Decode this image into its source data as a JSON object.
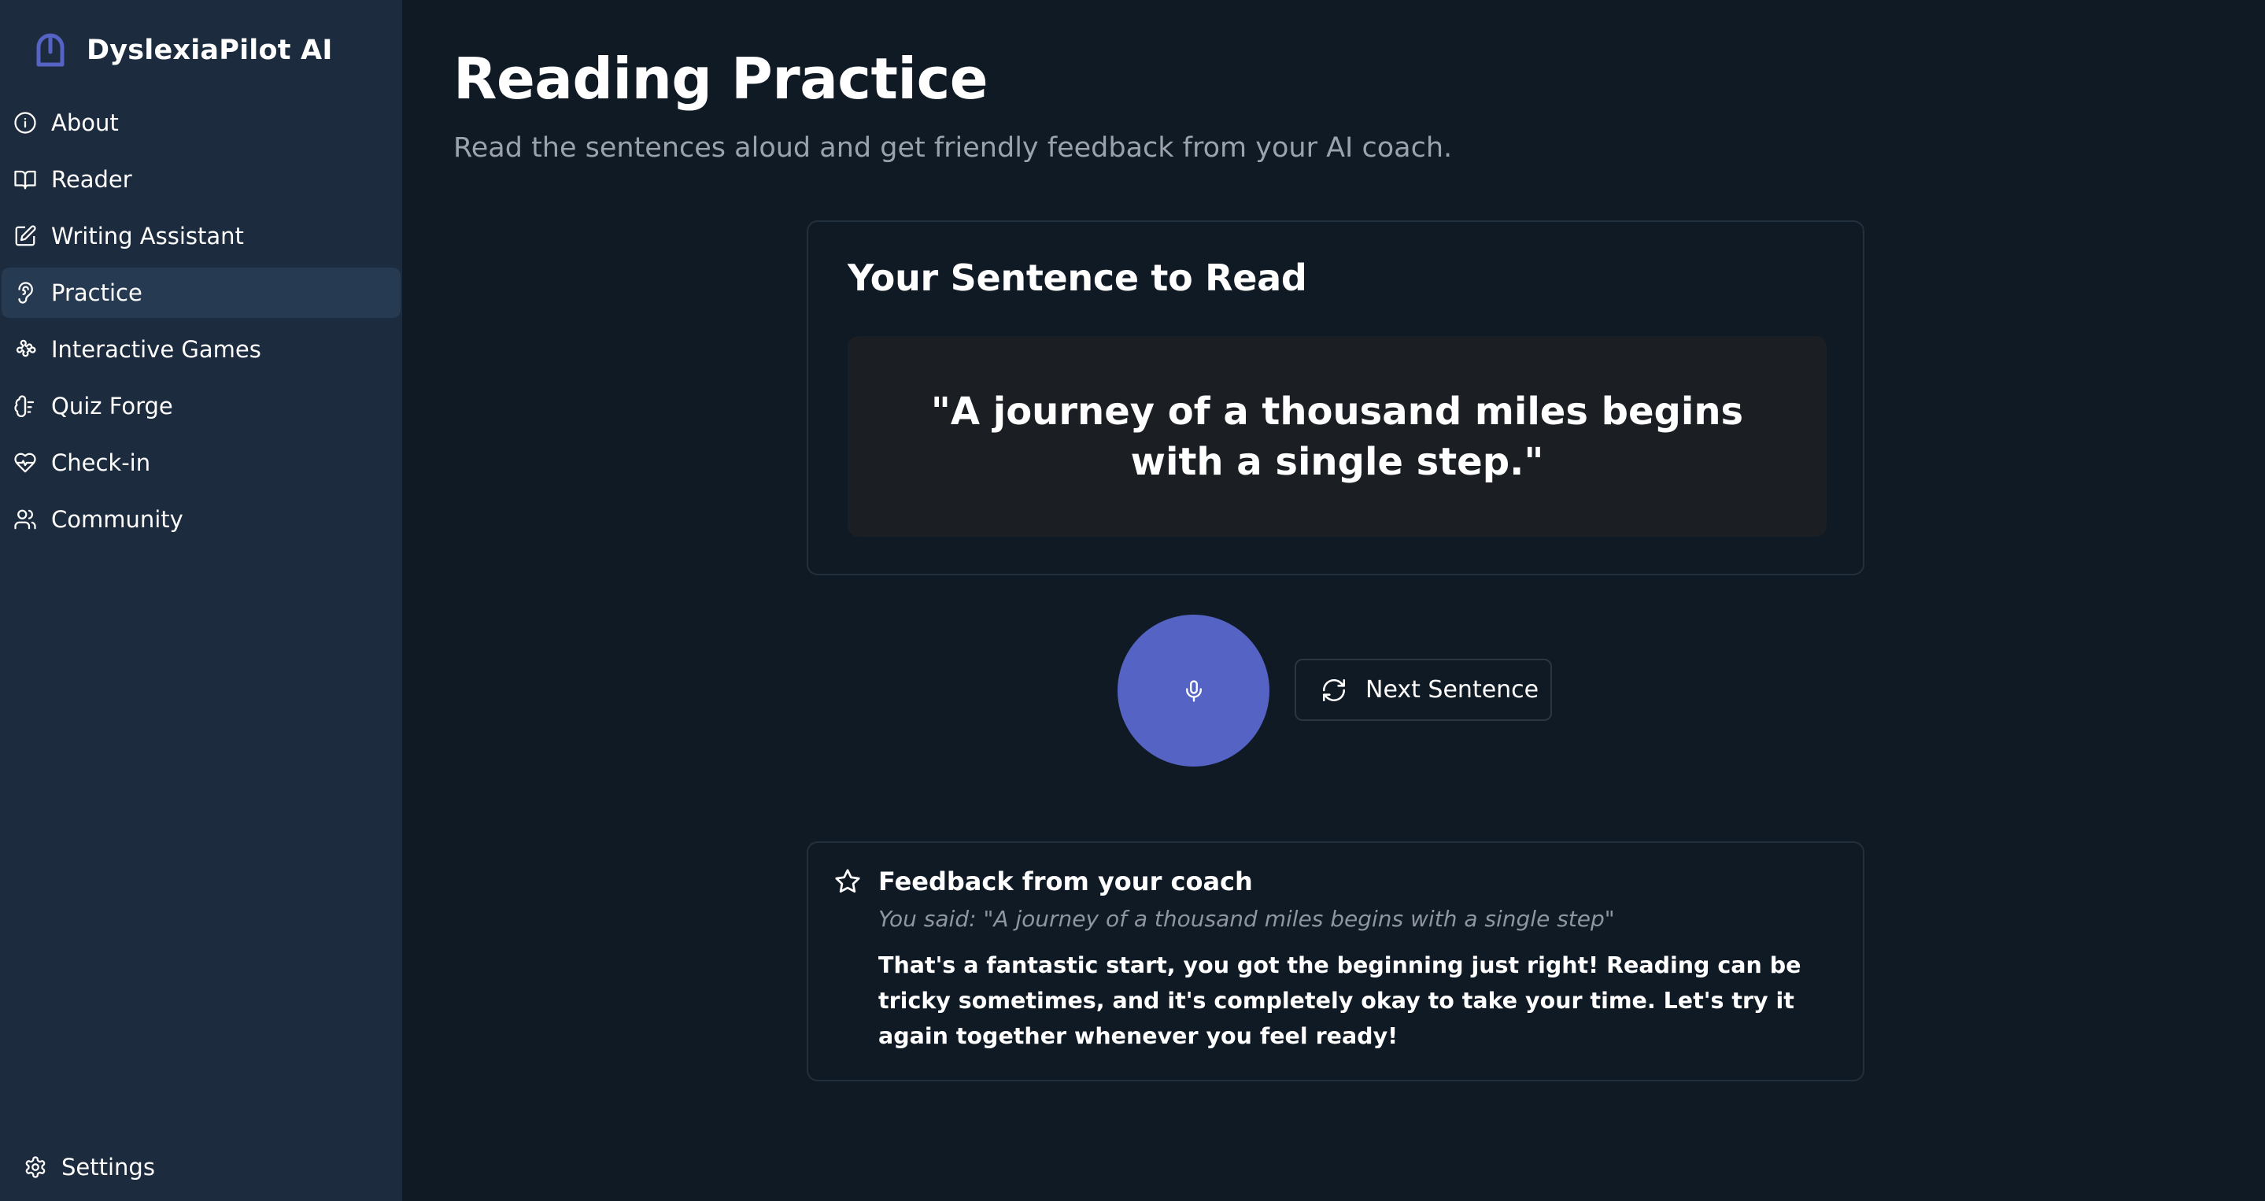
{
  "app": {
    "name": "DyslexiaPilot AI",
    "accent_color": "#5563c5"
  },
  "sidebar": {
    "items": [
      {
        "label": "About",
        "icon": "info-icon",
        "active": false
      },
      {
        "label": "Reader",
        "icon": "book-open-icon",
        "active": false
      },
      {
        "label": "Writing Assistant",
        "icon": "edit-icon",
        "active": false
      },
      {
        "label": "Practice",
        "icon": "ear-icon",
        "active": true
      },
      {
        "label": "Interactive Games",
        "icon": "puzzle-icon",
        "active": false
      },
      {
        "label": "Quiz Forge",
        "icon": "brain-icon",
        "active": false
      },
      {
        "label": "Check-in",
        "icon": "heart-pulse-icon",
        "active": false
      },
      {
        "label": "Community",
        "icon": "users-icon",
        "active": false
      }
    ],
    "settings_label": "Settings"
  },
  "main": {
    "title": "Reading Practice",
    "subtitle": "Read the sentences aloud and get friendly feedback from your AI coach.",
    "sentence_card": {
      "title": "Your Sentence to Read",
      "sentence": "\"A journey of a thousand miles begins with a single step.\""
    },
    "controls": {
      "mic_icon": "microphone-icon",
      "next_label": "Next Sentence",
      "next_icon": "refresh-icon"
    },
    "feedback": {
      "icon": "star-icon",
      "title": "Feedback from your coach",
      "you_said": "You said: \"A journey of a thousand miles begins with a single step\"",
      "message": "That's a fantastic start, you got the beginning just right! Reading can be tricky sometimes, and it's completely okay to take your time. Let's try it again together whenever you feel ready!"
    }
  }
}
